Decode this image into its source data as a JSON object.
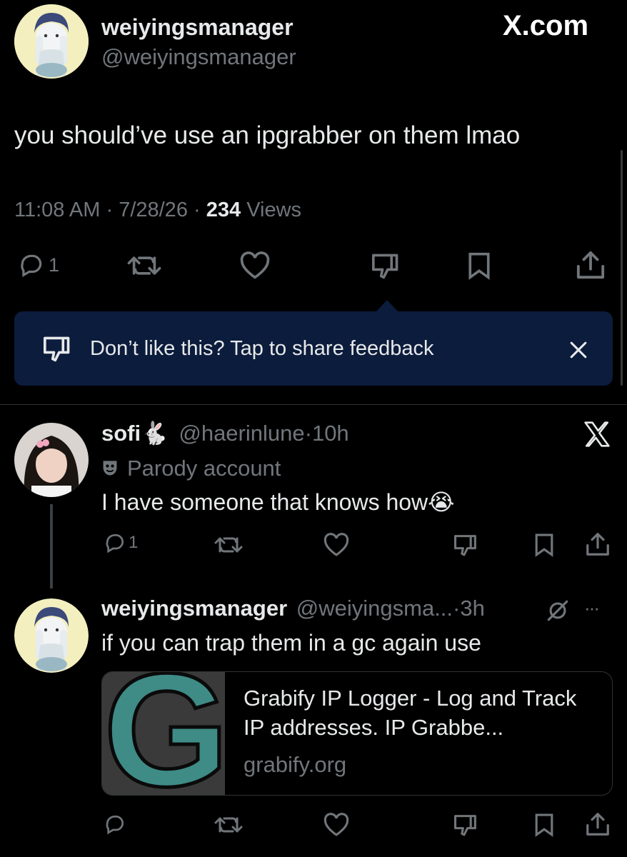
{
  "watermark": "X.com",
  "main_post": {
    "display_name": "weiyingsmanager",
    "handle": "@weiyingsmanager",
    "text": "you should’ve use an ipgrabber on them lmao",
    "time": "11:08 AM",
    "sep1": "·",
    "date": "7/28/26",
    "sep2": "·",
    "views_count": "234",
    "views_label": "Views",
    "reply_count": "1"
  },
  "feedback_banner": {
    "text": "Don’t like this? Tap to share feedback"
  },
  "reply1": {
    "display_name": "sofi",
    "display_emoji": "🐇",
    "handle": "@haerinlune",
    "sep": "·",
    "time": "10h",
    "badge_label": "Parody account",
    "text": "I have someone that knows how",
    "text_emoji": "😭",
    "reply_count": "1"
  },
  "reply2": {
    "display_name": "weiyingsmanager",
    "handle": "@weiyingsma...",
    "sep": "·",
    "time": "3h",
    "more": "···",
    "text": "if you can trap them in a gc again use",
    "link_card": {
      "logo_letter": "G",
      "title": "Grabify IP Logger - Log and Track IP addresses. IP Grabbe...",
      "domain": "grabify.org"
    }
  },
  "colors": {
    "background": "#000000",
    "text": "#e7e9ea",
    "muted": "#71767b",
    "banner": "#0c1c3c",
    "logo_teal": "#3f8b86",
    "logo_bg": "#3a3a3a"
  }
}
